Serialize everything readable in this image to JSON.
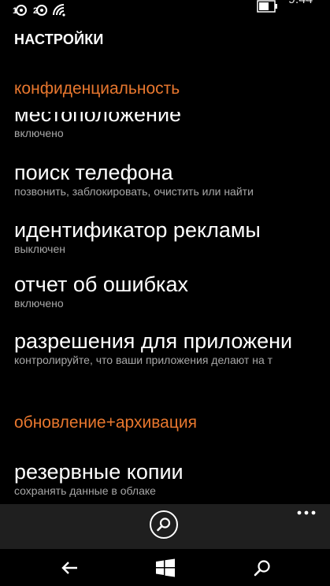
{
  "status_bar": {
    "clock": "9:44",
    "icons": [
      "sim1-signal-icon",
      "sim2-signal-icon",
      "wifi-icon",
      "battery-icon"
    ]
  },
  "page_title": "НАСТРОЙКИ",
  "sections": {
    "privacy": {
      "header": "конфиденциальность",
      "items": [
        {
          "title": "местоположение",
          "subtitle": "включено"
        },
        {
          "title": "поиск телефона",
          "subtitle": "позвонить, заблокировать, очистить или найти"
        },
        {
          "title": "идентификатор рекламы",
          "subtitle": "выключен"
        },
        {
          "title": "отчет об ошибках",
          "subtitle": "включено"
        },
        {
          "title": "разрешения для приложени",
          "subtitle": "контролируйте, что ваши приложения делают на т"
        }
      ]
    },
    "update": {
      "header": "обновление+архивация",
      "items": [
        {
          "title": "резервные копии",
          "subtitle": "сохранять данные в облаке"
        }
      ]
    }
  },
  "app_bar": {
    "icons": [
      "search-icon",
      "more-icon"
    ]
  },
  "nav_bar": {
    "icons": [
      "back-icon",
      "windows-start-icon",
      "search-icon"
    ]
  },
  "colors": {
    "accent": "#e8772e",
    "background": "#000000",
    "app_bar": "#1f1f1f",
    "subtitle": "#a8a8a8"
  }
}
